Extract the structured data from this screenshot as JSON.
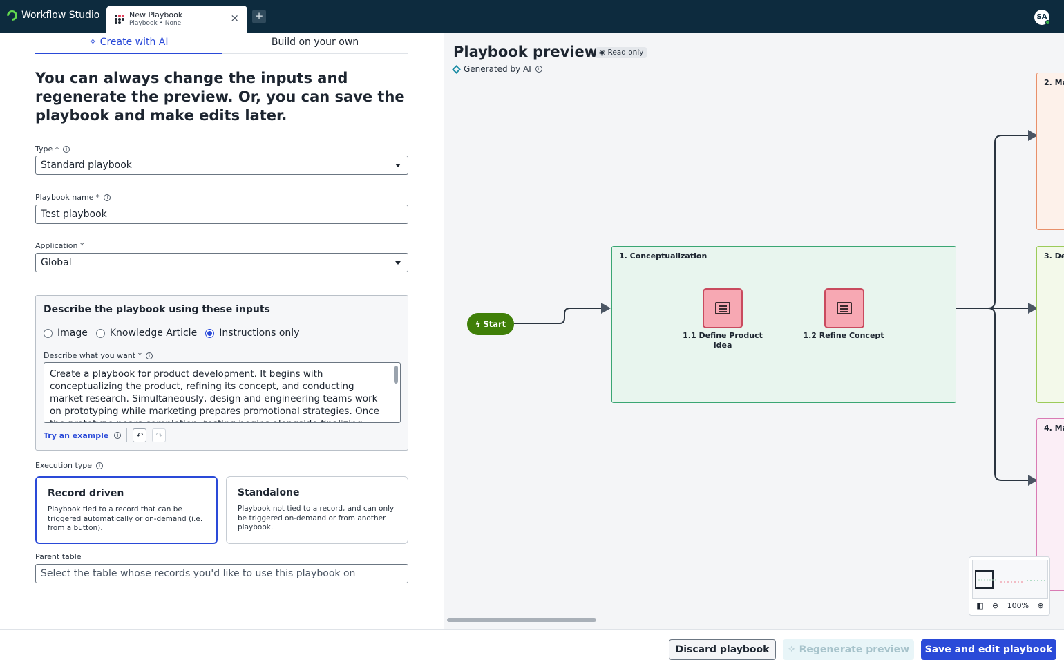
{
  "app": {
    "title": "Workflow Studio",
    "tab_title": "New Playbook",
    "tab_subtitle": "Playbook • None",
    "close_glyph": "×",
    "add_tab_glyph": "+",
    "user_initials": "SA"
  },
  "mode_tabs": {
    "ai_label": "Create with AI",
    "own_label": "Build on your own"
  },
  "form": {
    "heading": "You can always change the inputs and regenerate the preview. Or, you can save the playbook and make edits later.",
    "type_label": "Type *",
    "type_value": "Standard playbook",
    "name_label": "Playbook name *",
    "name_value": "Test playbook",
    "application_label": "Application *",
    "application_value": "Global",
    "describe": {
      "title": "Describe the playbook using these inputs",
      "options": [
        "Image",
        "Knowledge Article",
        "Instructions only"
      ],
      "selected_option": "Instructions only",
      "want_label": "Describe what you want *",
      "want_value": "Create a playbook for product development. It begins with conceptualizing the product, refining its concept, and conducting market research. Simultaneously, design and engineering teams work on prototyping while marketing prepares promotional strategies. Once the prototype nears completion, testing begins alongside finalizing",
      "example_link": "Try an example"
    },
    "execution_label": "Execution type",
    "execution_types": [
      {
        "title": "Record driven",
        "desc": "Playbook tied to a record that can be triggered automatically or on-demand (i.e. from a button).",
        "selected": true
      },
      {
        "title": "Standalone",
        "desc": "Playbook not tied to a record, and can only be triggered on-demand or from another playbook.",
        "selected": false
      }
    ],
    "parent_table_label": "Parent table",
    "parent_table_placeholder": "Select the table whose records you'd like to use this playbook on"
  },
  "preview": {
    "title": "Playbook preview",
    "readonly_badge": "Read only",
    "generated_label": "Generated by AI",
    "start_label": "Start",
    "stages": [
      {
        "label": "1. Conceptualization",
        "color": "#3aa673",
        "bg": "#e8f5ee"
      },
      {
        "label": "2. Ma",
        "color": "#e8906a",
        "bg": "#fdf1ea"
      },
      {
        "label": "3. De",
        "color": "#9ccb5a",
        "bg": "#f3f9ea"
      },
      {
        "label": "4. Ma",
        "color": "#d97bb4",
        "bg": "#fbeef6"
      }
    ],
    "steps": [
      {
        "label": "1.1 Define Product Idea"
      },
      {
        "label": "1.2 Refine Concept"
      }
    ],
    "zoom_level": "100%"
  },
  "footer": {
    "discard_label": "Discard playbook",
    "regenerate_label": "Regenerate preview",
    "save_label": "Save and edit playbook"
  }
}
